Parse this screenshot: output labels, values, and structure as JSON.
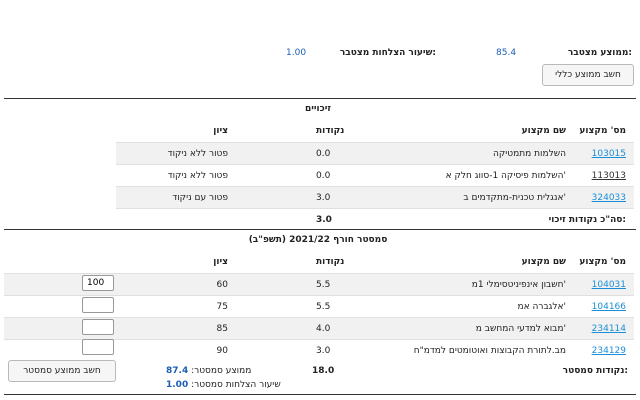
{
  "summary": {
    "cum_avg_label": "ממוצע מצטבר:",
    "cum_avg_value": "85.4",
    "cum_success_label": "שיעור הצלחות מצטבר:",
    "cum_success_value": "1.00",
    "calc_overall_button": "חשב ממוצע כללי"
  },
  "credits": {
    "title": "זיכויים",
    "headers": {
      "code": "מס' מקצוע",
      "name": "שם מקצוע",
      "points": "נקודות",
      "grade": "ציון"
    },
    "rows": [
      {
        "code": "103015",
        "name": "השלמות מתמטיקה",
        "points": "0.0",
        "grade": "פטור ללא ניקוד"
      },
      {
        "code": "113013",
        "name": "השלמות פיסיקה 1-סווג חלק א'",
        "points": "0.0",
        "grade": "פטור ללא ניקוד"
      },
      {
        "code": "324033",
        "name": "אנגלית טכנית-מתקדמים ב'",
        "points": "3.0",
        "grade": "פטור עם ניקוד"
      }
    ],
    "total_label": "סה\"כ נקודות זיכוי:",
    "total_value": "3.0"
  },
  "semester": {
    "title": "סמסטר חורף 2021/22 (תשפ\"ב)",
    "headers": {
      "code": "מס' מקצוע",
      "name": "שם מקצוע",
      "points": "נקודות",
      "grade": "ציון"
    },
    "rows": [
      {
        "code": "104031",
        "name": "חשבון אינפיניטסימלי 1מ'",
        "points": "5.5",
        "grade": "60",
        "input": "100"
      },
      {
        "code": "104166",
        "name": "אלגברה אמ'",
        "points": "5.5",
        "grade": "75",
        "input": ""
      },
      {
        "code": "234114",
        "name": "מבוא למדעי המחשב מ'",
        "points": "4.0",
        "grade": "85",
        "input": ""
      },
      {
        "code": "234129",
        "name": "מב.לתורת הקבוצות ואוטומטים למדמ\"ח",
        "points": "3.0",
        "grade": "90",
        "input": ""
      }
    ],
    "points_label": "נקודות סמסטר:",
    "points_value": "18.0",
    "avg_label": "ממוצע סמסטר:",
    "avg_value": "87.4",
    "success_label": "שיעור הצלחות סמסטר:",
    "success_value": "1.00",
    "calc_button": "חשב ממוצע סמסטר"
  }
}
